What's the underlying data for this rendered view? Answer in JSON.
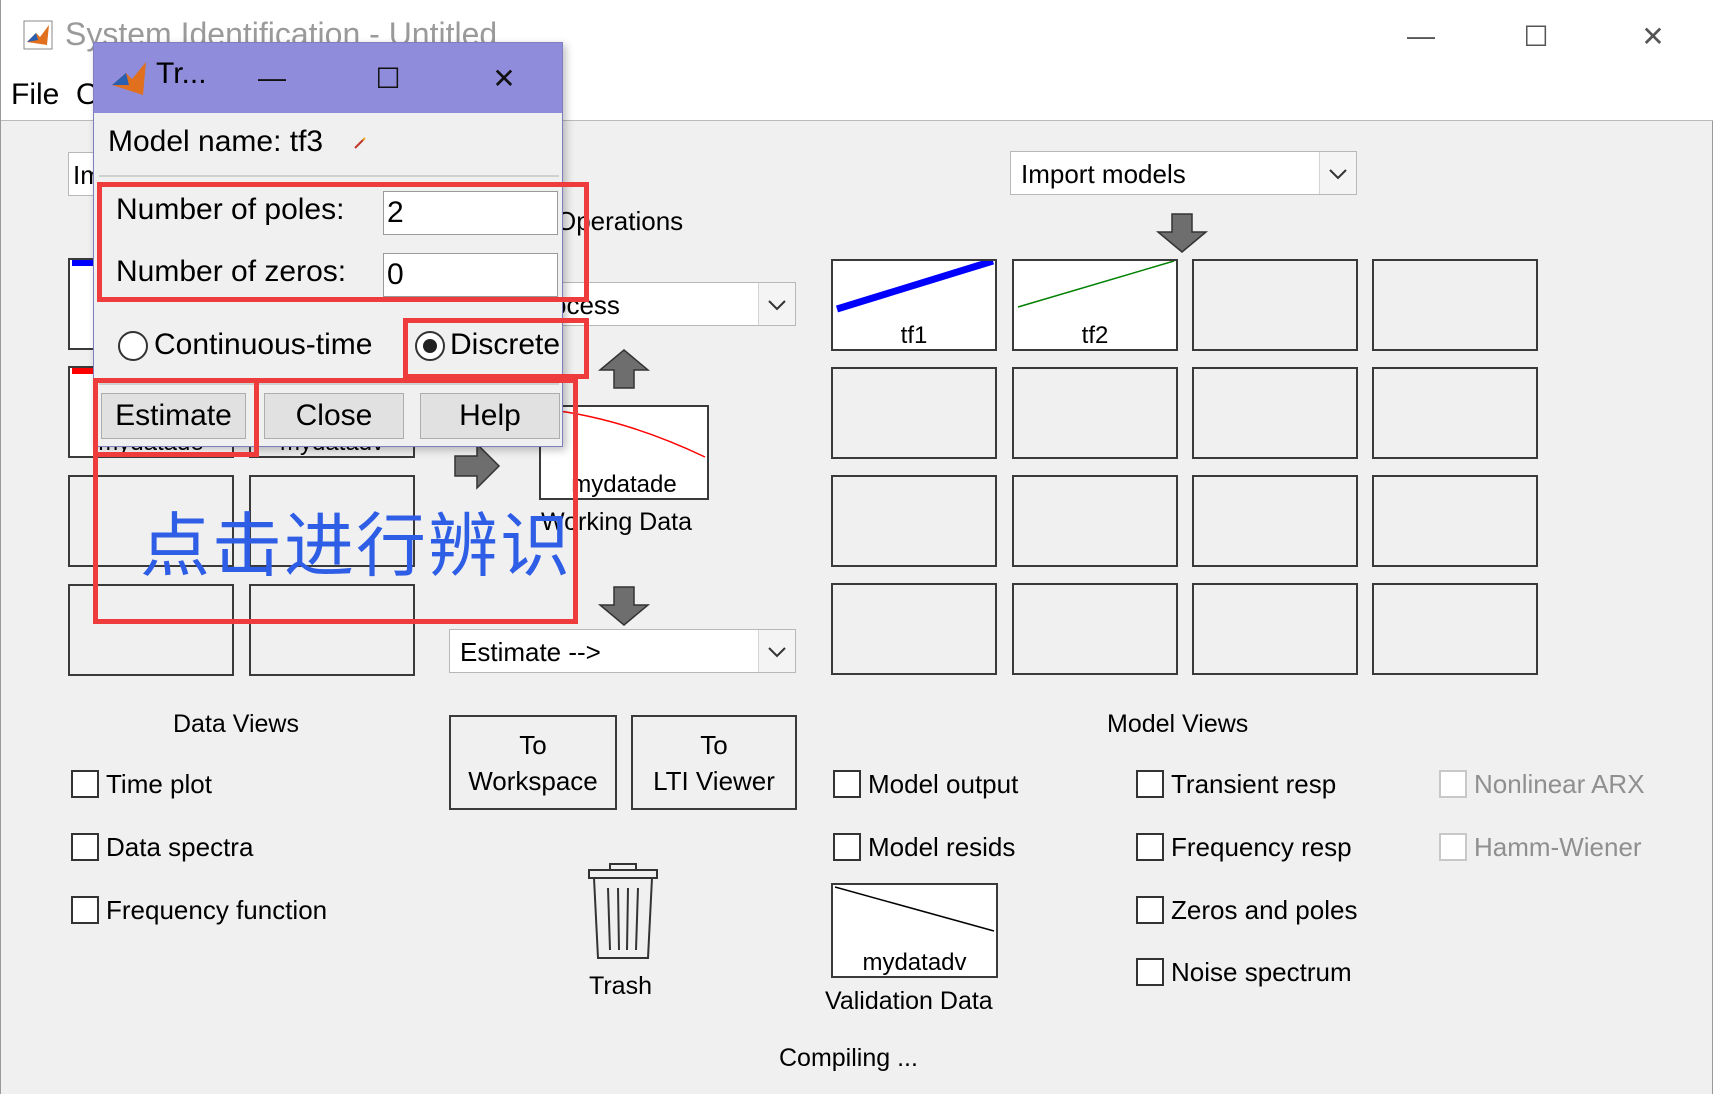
{
  "main_window": {
    "title": "System Identification - Untitled",
    "controls": {
      "minimize": "—",
      "maximize": "☐",
      "close": "✕"
    },
    "menu": [
      "File",
      "O"
    ]
  },
  "data_area": {
    "import_dropdown_partial": "Im",
    "slots": [
      {
        "label": "mydatade"
      },
      {
        "label": "mydatadv"
      }
    ]
  },
  "operations": {
    "title_partial": "Operations",
    "preprocess_partial": "ocess",
    "working_data": {
      "slot_label": "mydatade",
      "caption": "Working Data"
    },
    "estimate_dropdown": "Estimate -->"
  },
  "models": {
    "import_dropdown": "Import models",
    "slots": [
      {
        "label": "tf1",
        "color": "#0000ff"
      },
      {
        "label": "tf2",
        "color": "#008000"
      }
    ]
  },
  "data_views": {
    "title": "Data Views",
    "checkboxes": [
      "Time plot",
      "Data spectra",
      "Frequency function"
    ]
  },
  "buttons": {
    "to_workspace": [
      "To",
      "Workspace"
    ],
    "to_lti": [
      "To",
      "LTI Viewer"
    ]
  },
  "trash": {
    "label": "Trash"
  },
  "validation": {
    "slot_label": "mydatadv",
    "caption": "Validation Data"
  },
  "model_views": {
    "title": "Model Views",
    "col1": [
      "Model output",
      "Model resids"
    ],
    "col2": [
      "Transient resp",
      "Frequency resp",
      "Zeros and poles",
      "Noise spectrum"
    ],
    "col3": [
      "Nonlinear ARX",
      "Hamm-Wiener"
    ]
  },
  "status": "Compiling ...",
  "dialog": {
    "title": "Tr...",
    "model_name_label": "Model name: tf3",
    "poles_label": "Number of poles:",
    "poles_value": "2",
    "zeros_label": "Number of zeros:",
    "zeros_value": "0",
    "radio_continuous": "Continuous-time",
    "radio_discrete": "Discrete",
    "selected_radio": "Discrete",
    "buttons": {
      "estimate": "Estimate",
      "close": "Close",
      "help": "Help"
    }
  },
  "annotation": {
    "text": "点击进行辨识",
    "color": "#2f5ee6"
  },
  "highlight_color": "#ee3b3b"
}
